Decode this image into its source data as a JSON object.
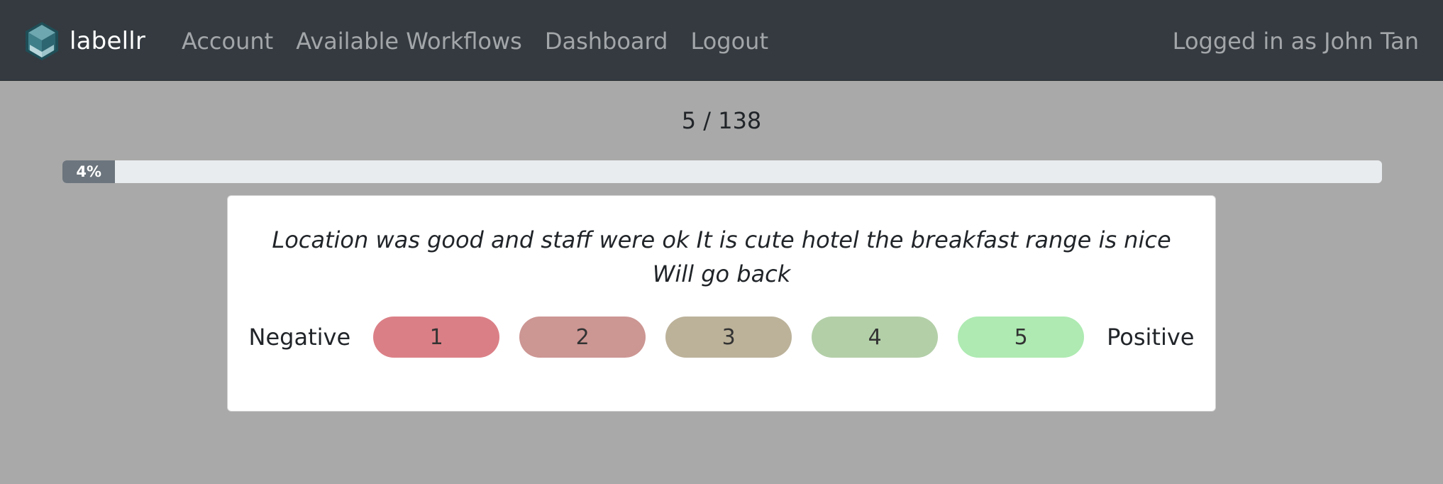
{
  "nav": {
    "brand": "labellr",
    "links": [
      "Account",
      "Available Workflows",
      "Dashboard",
      "Logout"
    ],
    "user_text": "Logged in as John Tan"
  },
  "progress": {
    "counter": "5 / 138",
    "percent_label": "4%",
    "fraction": 0.04
  },
  "task": {
    "text": "Location was good and staff were ok It is cute hotel the breakfast range is nice Will go back",
    "scale_low_label": "Negative",
    "scale_high_label": "Positive",
    "options": [
      {
        "label": "1",
        "color": "#db7f86"
      },
      {
        "label": "2",
        "color": "#cc9693"
      },
      {
        "label": "3",
        "color": "#bcb29a"
      },
      {
        "label": "4",
        "color": "#b3cfa8"
      },
      {
        "label": "5",
        "color": "#aeeab2"
      }
    ]
  },
  "colors": {
    "navbar_bg": "#343a40",
    "page_bg": "#a9a9a9",
    "progress_fill": "#6c757d",
    "progress_track": "#e9ecef"
  },
  "icons": {
    "brand_logo": "cube-logo-icon"
  }
}
